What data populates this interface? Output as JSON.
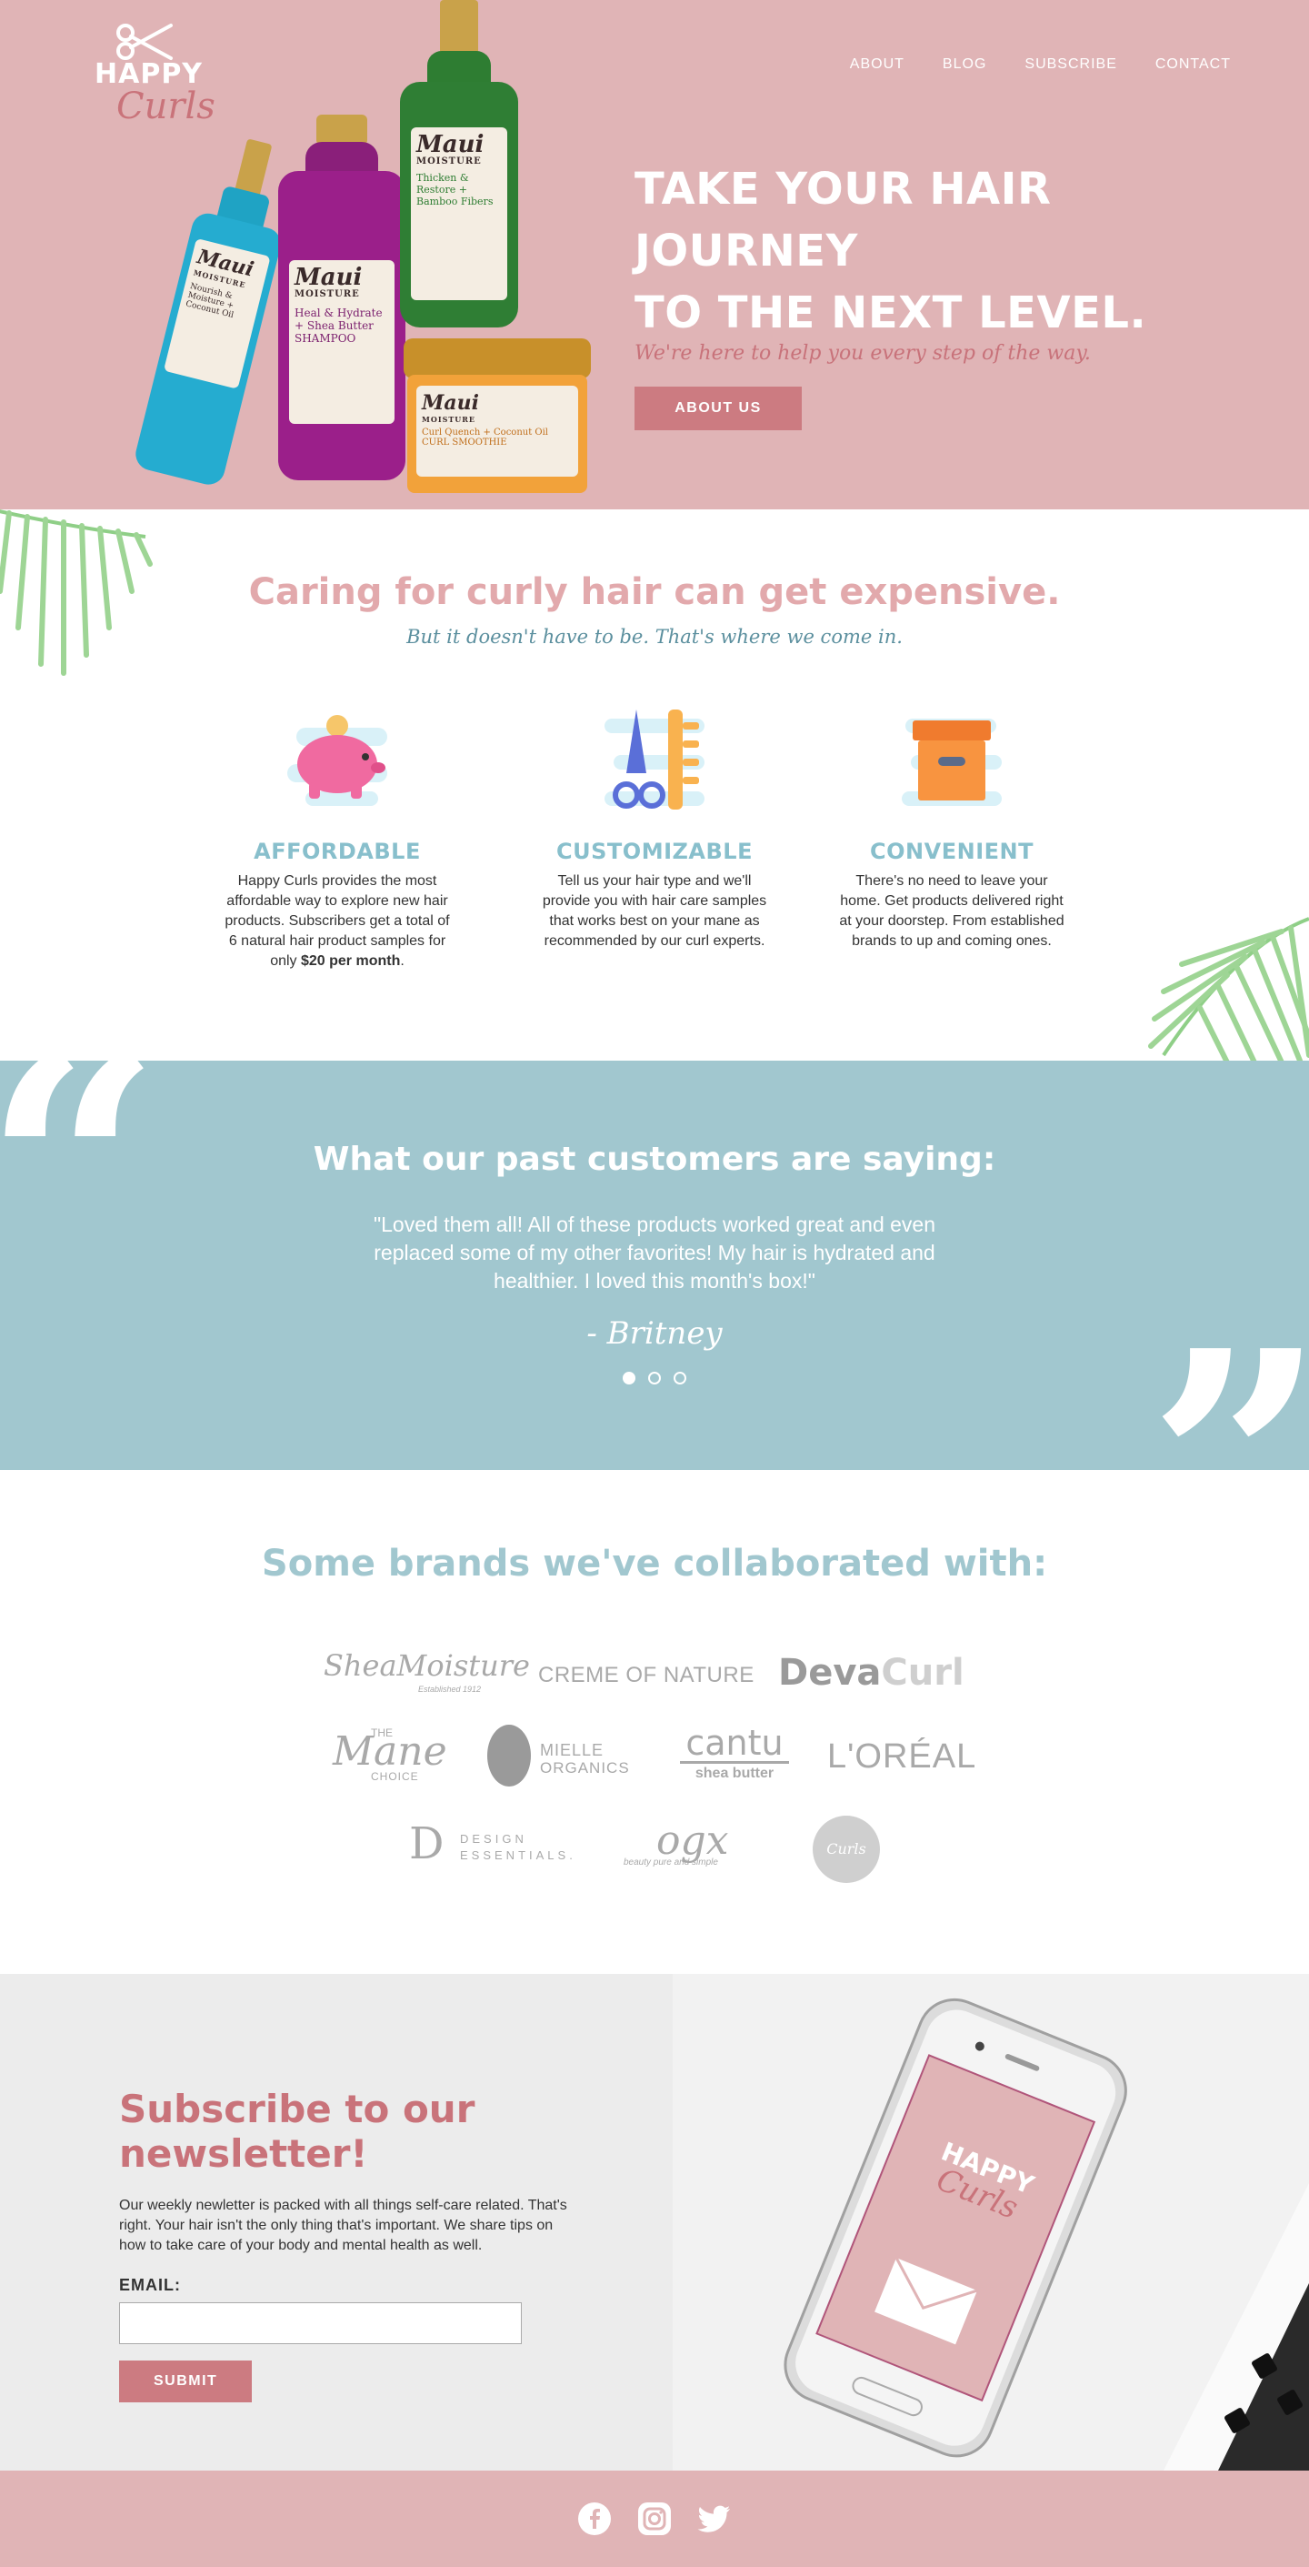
{
  "header": {
    "logo_happy": "HAPPY",
    "logo_curls": "Curls",
    "nav": [
      "ABOUT",
      "BLOG",
      "SUBSCRIBE",
      "CONTACT"
    ]
  },
  "hero": {
    "headline_line1": "TAKE YOUR HAIR JOURNEY",
    "headline_line2": "TO THE NEXT LEVEL.",
    "tagline": "We're here to help you every step of the way.",
    "button": "ABOUT US",
    "products": [
      {
        "brand": "Maui",
        "sub": "MOISTURE",
        "text": "Heal & Hydrate + Shea Butter SHAMPOO"
      },
      {
        "brand": "Maui",
        "sub": "MOISTURE",
        "text": "Thicken & Restore + Bamboo Fibers"
      },
      {
        "brand": "Maui",
        "sub": "MOISTURE",
        "text": "Curl Quench + Coconut Oil CURL SMOOTHIE"
      },
      {
        "brand": "Maui",
        "sub": "MOISTURE",
        "text": "Nourish & Moisture + Coconut Oil"
      }
    ]
  },
  "caring": {
    "title": "Caring for curly hair can get expensive.",
    "subtitle": "But it doesn't have to be. That's where we come in.",
    "features": [
      {
        "title": "AFFORDABLE",
        "text_before": "Happy Curls provides the most affordable way to explore new hair products. Subscribers get a total of 6 natural hair product samples for only ",
        "text_bold": "$20 per month",
        "text_after": "."
      },
      {
        "title": "CUSTOMIZABLE",
        "text": "Tell us your hair type and we'll provide you with hair care samples that works best on your mane as recommended by our curl experts."
      },
      {
        "title": "CONVENIENT",
        "text": "There's no need to leave your home. Get products delivered right at your doorstep. From established brands to up and coming ones."
      }
    ]
  },
  "testimonial": {
    "title": "What our past customers are saying:",
    "quote": "\"Loved them all! All of these products worked great and even replaced some of my other favorites! My hair is hydrated and healthier. I loved this month's box!\"",
    "author": "- Britney",
    "open_mark": "“",
    "close_mark": "”"
  },
  "brands": {
    "title": "Some brands we've collaborated with:",
    "logos": {
      "shea": "SheaMoisture",
      "shea_sub": "Established 1912",
      "creme": "CREME OF NATURE",
      "deva1": "Deva",
      "deva2": "Curl",
      "mane_the": "THE",
      "mane": "Mane",
      "mane_choice": "CHOICE",
      "mielle": "MIELLE",
      "mielle_sub": "ORGANICS",
      "cantu": "cantu",
      "cantu_sub": "shea butter",
      "loreal": "L'ORÉAL",
      "design": "DESIGN",
      "design2": "ESSENTIALS.",
      "ogx": "ogx",
      "ogx_sub": "beauty pure and simple",
      "curls": "Curls"
    }
  },
  "subscribe": {
    "title": "Subscribe to our newsletter!",
    "text": "Our weekly newletter is packed with all things self-care related. That's right. Your hair isn't the only thing that's important. We share tips on how to take care of your body and mental health as well.",
    "email_label": "EMAIL:",
    "email_value": "",
    "button": "SUBMIT",
    "phone_logo_happy": "HAPPY",
    "phone_logo_curls": "Curls"
  },
  "colors": {
    "hero_pink": "#e0b4b6",
    "accent": "#cc7b81",
    "teal": "#a1c7cf",
    "gray": "#ececec"
  },
  "social": [
    "facebook-icon",
    "instagram-icon",
    "twitter-icon"
  ]
}
